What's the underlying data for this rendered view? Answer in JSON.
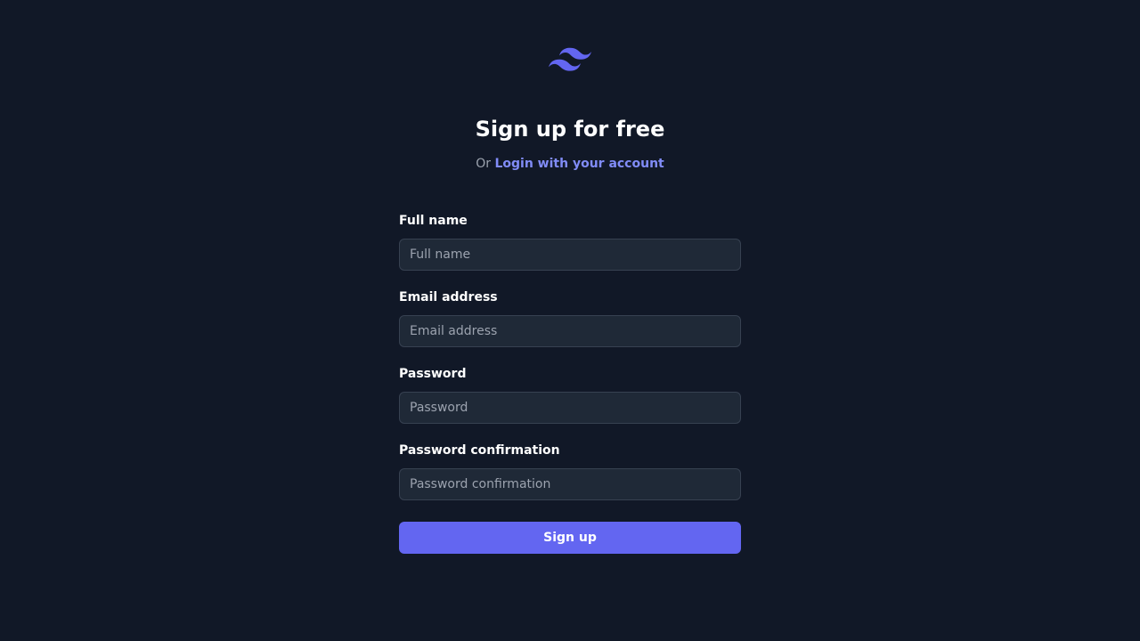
{
  "brand": {
    "logo_icon": "tailwind-wave-icon",
    "accent_color": "#6366f1"
  },
  "header": {
    "title": "Sign up for free",
    "subtitle_prefix": "Or",
    "login_link": "Login with your account"
  },
  "form": {
    "full_name": {
      "label": "Full name",
      "placeholder": "Full name",
      "value": ""
    },
    "email": {
      "label": "Email address",
      "placeholder": "Email address",
      "value": ""
    },
    "password": {
      "label": "Password",
      "placeholder": "Password",
      "value": ""
    },
    "password_confirmation": {
      "label": "Password confirmation",
      "placeholder": "Password confirmation",
      "value": ""
    },
    "submit_label": "Sign up"
  },
  "colors": {
    "background": "#111827",
    "input_background": "#1f2937",
    "input_border": "#374151",
    "link": "#818cf8",
    "muted_text": "#9ca3af"
  }
}
